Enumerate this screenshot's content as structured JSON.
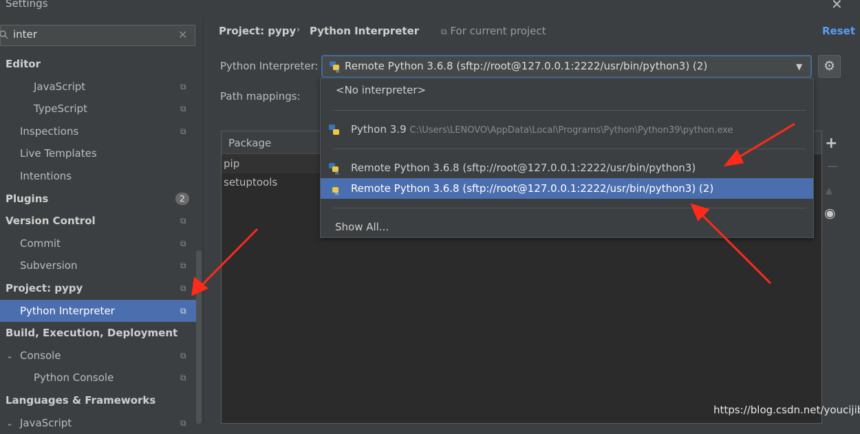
{
  "window": {
    "title": "Settings"
  },
  "search": {
    "value": "inter"
  },
  "tree": [
    {
      "label": "Editor",
      "bold": true,
      "indent": 0,
      "copy": false
    },
    {
      "label": "JavaScript",
      "bold": false,
      "indent": 2,
      "copy": true
    },
    {
      "label": "TypeScript",
      "bold": false,
      "indent": 2,
      "copy": true
    },
    {
      "label": "Inspections",
      "bold": false,
      "indent": 1,
      "copy": true
    },
    {
      "label": "Live Templates",
      "bold": false,
      "indent": 1,
      "copy": false
    },
    {
      "label": "Intentions",
      "bold": false,
      "indent": 1,
      "copy": false
    },
    {
      "label": "Plugins",
      "bold": true,
      "indent": 0,
      "copy": false,
      "badge": "2"
    },
    {
      "label": "Version Control",
      "bold": true,
      "indent": 0,
      "copy": true
    },
    {
      "label": "Commit",
      "bold": false,
      "indent": 1,
      "copy": true
    },
    {
      "label": "Subversion",
      "bold": false,
      "indent": 1,
      "copy": true
    },
    {
      "label": "Project: pypy",
      "bold": true,
      "indent": 0,
      "copy": true
    },
    {
      "label": "Python Interpreter",
      "bold": false,
      "indent": 1,
      "copy": true,
      "selected": true
    },
    {
      "label": "Build, Execution, Deployment",
      "bold": true,
      "indent": 0,
      "copy": false
    },
    {
      "label": "Console",
      "bold": false,
      "indent": 1,
      "copy": true,
      "expanded": true
    },
    {
      "label": "Python Console",
      "bold": false,
      "indent": 2,
      "copy": true
    },
    {
      "label": "Languages & Frameworks",
      "bold": true,
      "indent": 0,
      "copy": false
    },
    {
      "label": "JavaScript",
      "bold": false,
      "indent": 1,
      "copy": true,
      "expanded": true
    }
  ],
  "header": {
    "crumb_project": "Project: pypy",
    "crumb_page": "Python Interpreter",
    "for_current": "For current project",
    "reset": "Reset"
  },
  "form": {
    "interpreter_label": "Python Interpreter:",
    "path_mappings_label": "Path mappings:",
    "selected_interpreter": "Remote Python 3.6.8 (sftp://root@127.0.0.1:2222/usr/bin/python3) (2)"
  },
  "packages": {
    "header": "Package",
    "rows": [
      "pip",
      "setuptools"
    ]
  },
  "dropdown": {
    "no_interpreter": "<No interpreter>",
    "python39_name": "Python 3.9",
    "python39_path": "C:\\Users\\LENOVO\\AppData\\Local\\Programs\\Python\\Python39\\python.exe",
    "remote1": "Remote Python 3.6.8 (sftp://root@127.0.0.1:2222/usr/bin/python3)",
    "remote2": "Remote Python 3.6.8 (sftp://root@127.0.0.1:2222/usr/bin/python3) (2)",
    "show_all": "Show All..."
  },
  "watermark": "https://blog.csdn.net/youcijibi",
  "colors": {
    "background": "#3c3f41",
    "selection": "#4b6eaf",
    "link": "#589df6",
    "annotation_arrow": "#ff2a1a"
  }
}
